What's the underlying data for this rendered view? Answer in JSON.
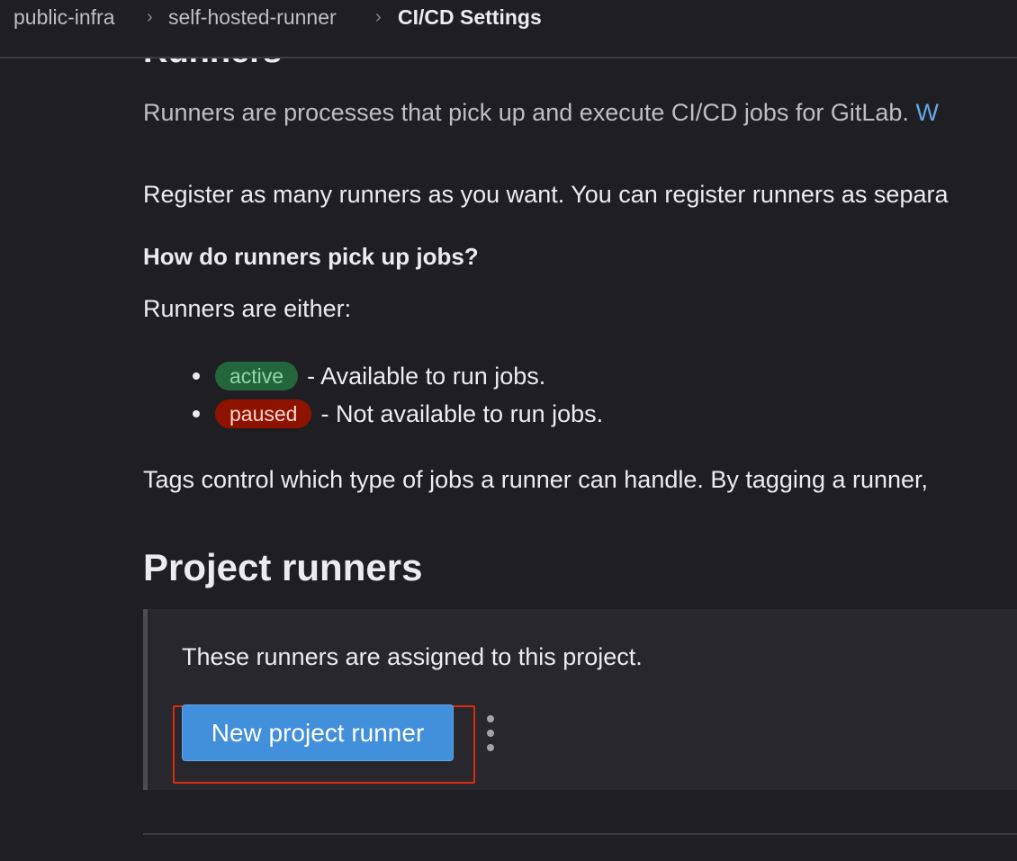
{
  "breadcrumb": {
    "items": [
      "public-infra",
      "self-hosted-runner",
      "CI/CD Settings"
    ]
  },
  "runners_section": {
    "title": "Runners",
    "intro": "Runners are processes that pick up and execute CI/CD jobs for GitLab.",
    "intro_link": "W",
    "register_text": "Register as many runners as you want. You can register runners as separa",
    "how_heading": "How do runners pick up jobs?",
    "either_text": "Runners are either:",
    "states": [
      {
        "badge": "active",
        "description": "- Available to run jobs."
      },
      {
        "badge": "paused",
        "description": "- Not available to run jobs."
      }
    ],
    "tags_text": "Tags control which type of jobs a runner can handle. By tagging a runner,"
  },
  "project_runners": {
    "title": "Project runners",
    "description": "These runners are assigned to this project.",
    "new_button_label": "New project runner"
  },
  "colors": {
    "background": "#1f1f23",
    "card": "#28272d",
    "primary_button": "#428fdc",
    "active_badge": "#24663b",
    "paused_badge": "#8d1300",
    "highlight": "#dd2b0e",
    "link": "#63a6e9"
  },
  "icons": {
    "breadcrumb_separator": "chevron-right-icon",
    "more_actions": "ellipsis-v-icon"
  }
}
